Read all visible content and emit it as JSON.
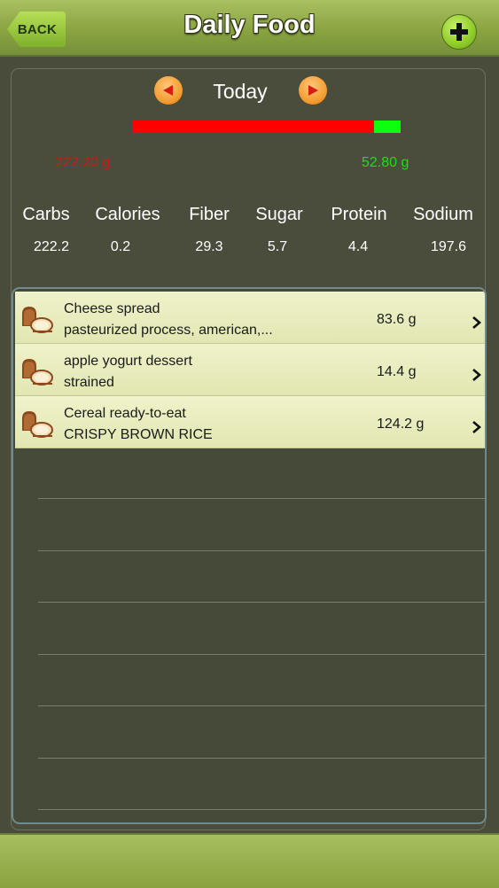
{
  "header": {
    "back_label": "BACK",
    "title": "Daily Food"
  },
  "day_nav": {
    "label": "Today"
  },
  "progress": {
    "consumed_value": "222.20 g",
    "remaining_value": "52.80 g",
    "fill_fraction": 0.1
  },
  "nutrients": {
    "headers": [
      "Carbs",
      "Calories",
      "Fiber",
      "Sugar",
      "Protein",
      "Sodium"
    ],
    "values": [
      "222.2",
      "0.2",
      "29.3",
      "5.7",
      "4.4",
      "197.6"
    ]
  },
  "food_items": [
    {
      "name": "Cheese spread",
      "subtitle": "pasteurized process, american,...",
      "amount": "83.6 g",
      "icon": "bread-icon"
    },
    {
      "name": "apple yogurt dessert",
      "subtitle": "strained",
      "amount": "14.4 g",
      "icon": "bread-icon"
    },
    {
      "name": "Cereal ready-to-eat",
      "subtitle": "CRISPY BROWN RICE",
      "amount": "124.2 g",
      "icon": "bread-icon"
    }
  ],
  "colors": {
    "header_green": "#8aa441",
    "bar_red": "#ff0000",
    "bar_green": "#0dff0d",
    "consumed_text": "#cc1a12",
    "remaining_text": "#18e018",
    "nav_orange": "#f39b2d"
  }
}
